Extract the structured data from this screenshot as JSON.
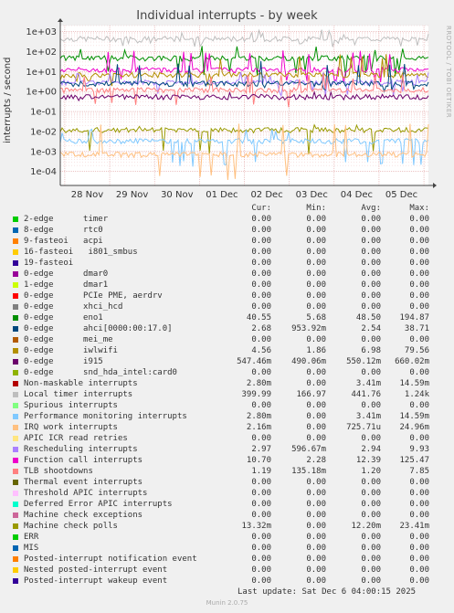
{
  "title": "Individual interrupts - by week",
  "side_text": "RRDTOOL / TOBI OETIKER",
  "footer": {
    "last_update": "Last update: Sat Dec  6 04:00:15 2025",
    "munin": "Munin 2.0.75"
  },
  "table_headers": [
    "Cur:",
    "Min:",
    "Avg:",
    "Max:"
  ],
  "chart_data": {
    "type": "line",
    "title": "Individual interrupts - by week",
    "ylabel": "interrupts / second",
    "y_scale": "log",
    "ylim": [
      2e-05,
      2000
    ],
    "y_ticks": [
      "1e+03",
      "1e+02",
      "1e+01",
      "1e+00",
      "1e-01",
      "1e-02",
      "1e-03",
      "1e-04"
    ],
    "x_ticks": [
      "28 Nov",
      "29 Nov",
      "30 Nov",
      "01 Dec",
      "02 Dec",
      "03 Dec",
      "04 Dec",
      "05 Dec"
    ],
    "grid": true,
    "series": [
      {
        "name": "2-edge      timer",
        "color": "#00cc00",
        "cur": "0.00",
        "min": "0.00",
        "avg": "0.00",
        "max": "0.00"
      },
      {
        "name": "8-edge      rtc0",
        "color": "#0066b3",
        "cur": "0.00",
        "min": "0.00",
        "avg": "0.00",
        "max": "0.00"
      },
      {
        "name": "9-fasteoi   acpi",
        "color": "#ff8000",
        "cur": "0.00",
        "min": "0.00",
        "avg": "0.00",
        "max": "0.00"
      },
      {
        "name": "16-fasteoi   i801_smbus",
        "color": "#ffcc00",
        "cur": "0.00",
        "min": "0.00",
        "avg": "0.00",
        "max": "0.00"
      },
      {
        "name": "19-fasteoi",
        "color": "#330099",
        "cur": "0.00",
        "min": "0.00",
        "avg": "0.00",
        "max": "0.00"
      },
      {
        "name": "0-edge      dmar0",
        "color": "#990099",
        "cur": "0.00",
        "min": "0.00",
        "avg": "0.00",
        "max": "0.00"
      },
      {
        "name": "1-edge      dmar1",
        "color": "#ccff00",
        "cur": "0.00",
        "min": "0.00",
        "avg": "0.00",
        "max": "0.00"
      },
      {
        "name": "0-edge      PCIe PME, aerdrv",
        "color": "#ff0000",
        "cur": "0.00",
        "min": "0.00",
        "avg": "0.00",
        "max": "0.00"
      },
      {
        "name": "0-edge      xhci_hcd",
        "color": "#808080",
        "cur": "0.00",
        "min": "0.00",
        "avg": "0.00",
        "max": "0.00"
      },
      {
        "name": "0-edge      eno1",
        "color": "#008f00",
        "cur": "40.55",
        "min": "5.68",
        "avg": "48.50",
        "max": "194.87"
      },
      {
        "name": "0-edge      ahci[0000:00:17.0]",
        "color": "#00487d",
        "cur": "2.68",
        "min": "953.92m",
        "avg": "2.54",
        "max": "38.71"
      },
      {
        "name": "0-edge      mei_me",
        "color": "#b35a00",
        "cur": "0.00",
        "min": "0.00",
        "avg": "0.00",
        "max": "0.00"
      },
      {
        "name": "0-edge      iwlwifi",
        "color": "#b38f00",
        "cur": "4.56",
        "min": "1.86",
        "avg": "6.98",
        "max": "79.56"
      },
      {
        "name": "0-edge      i915",
        "color": "#6b006b",
        "cur": "547.46m",
        "min": "490.06m",
        "avg": "550.12m",
        "max": "660.02m"
      },
      {
        "name": "0-edge      snd_hda_intel:card0",
        "color": "#8fb300",
        "cur": "0.00",
        "min": "0.00",
        "avg": "0.00",
        "max": "0.00"
      },
      {
        "name": "Non-maskable interrupts",
        "color": "#b30000",
        "cur": "2.80m",
        "min": "0.00",
        "avg": "3.41m",
        "max": "14.59m"
      },
      {
        "name": "Local timer interrupts",
        "color": "#bebebe",
        "cur": "399.99",
        "min": "166.97",
        "avg": "441.76",
        "max": "1.24k"
      },
      {
        "name": "Spurious interrupts",
        "color": "#80ff80",
        "cur": "0.00",
        "min": "0.00",
        "avg": "0.00",
        "max": "0.00"
      },
      {
        "name": "Performance monitoring interrupts",
        "color": "#80c9ff",
        "cur": "2.80m",
        "min": "0.00",
        "avg": "3.41m",
        "max": "14.59m"
      },
      {
        "name": "IRQ work interrupts",
        "color": "#ffc080",
        "cur": "2.16m",
        "min": "0.00",
        "avg": "725.71u",
        "max": "24.96m"
      },
      {
        "name": "APIC ICR read retries",
        "color": "#ffe680",
        "cur": "0.00",
        "min": "0.00",
        "avg": "0.00",
        "max": "0.00"
      },
      {
        "name": "Rescheduling interrupts",
        "color": "#aa80ff",
        "cur": "2.97",
        "min": "596.67m",
        "avg": "2.94",
        "max": "9.93"
      },
      {
        "name": "Function call interrupts",
        "color": "#ee00cc",
        "cur": "10.70",
        "min": "2.28",
        "avg": "12.39",
        "max": "125.47"
      },
      {
        "name": "TLB shootdowns",
        "color": "#ff8080",
        "cur": "1.19",
        "min": "135.18m",
        "avg": "1.20",
        "max": "7.85"
      },
      {
        "name": "Thermal event interrupts",
        "color": "#666600",
        "cur": "0.00",
        "min": "0.00",
        "avg": "0.00",
        "max": "0.00"
      },
      {
        "name": "Threshold APIC interrupts",
        "color": "#ffbfff",
        "cur": "0.00",
        "min": "0.00",
        "avg": "0.00",
        "max": "0.00"
      },
      {
        "name": "Deferred Error APIC interrupts",
        "color": "#00ffcc",
        "cur": "0.00",
        "min": "0.00",
        "avg": "0.00",
        "max": "0.00"
      },
      {
        "name": "Machine check exceptions",
        "color": "#cc6699",
        "cur": "0.00",
        "min": "0.00",
        "avg": "0.00",
        "max": "0.00"
      },
      {
        "name": "Machine check polls",
        "color": "#999900",
        "cur": "13.32m",
        "min": "0.00",
        "avg": "12.20m",
        "max": "23.41m"
      },
      {
        "name": "ERR",
        "color": "#00cc00",
        "cur": "0.00",
        "min": "0.00",
        "avg": "0.00",
        "max": "0.00"
      },
      {
        "name": "MIS",
        "color": "#0066b3",
        "cur": "0.00",
        "min": "0.00",
        "avg": "0.00",
        "max": "0.00"
      },
      {
        "name": "Posted-interrupt notification event",
        "color": "#ff8000",
        "cur": "0.00",
        "min": "0.00",
        "avg": "0.00",
        "max": "0.00"
      },
      {
        "name": "Nested posted-interrupt event",
        "color": "#ffcc00",
        "cur": "0.00",
        "min": "0.00",
        "avg": "0.00",
        "max": "0.00"
      },
      {
        "name": "Posted-interrupt wakeup event",
        "color": "#330099",
        "cur": "0.00",
        "min": "0.00",
        "avg": "0.00",
        "max": "0.00"
      }
    ],
    "plotted_levels": [
      {
        "series": "Local timer interrupts",
        "typical": 441.76,
        "min": 166.97,
        "max": 1240
      },
      {
        "series": "0-edge      eno1",
        "typical": 48.5,
        "min": 5.68,
        "max": 194.87
      },
      {
        "series": "Function call interrupts",
        "typical": 12.39,
        "min": 2.28,
        "max": 125.47
      },
      {
        "series": "0-edge      iwlwifi",
        "typical": 6.98,
        "min": 1.86,
        "max": 79.56
      },
      {
        "series": "Rescheduling interrupts",
        "typical": 2.94,
        "min": 0.59667,
        "max": 9.93
      },
      {
        "series": "0-edge      ahci[0000:00:17.0]",
        "typical": 2.54,
        "min": 0.95392,
        "max": 38.71
      },
      {
        "series": "TLB shootdowns",
        "typical": 1.2,
        "min": 0.13518,
        "max": 7.85
      },
      {
        "series": "0-edge      i915",
        "typical": 0.55012,
        "min": 0.49006,
        "max": 0.66002
      },
      {
        "series": "Machine check polls",
        "typical": 0.0122,
        "min": 0.0,
        "max": 0.02341
      },
      {
        "series": "Performance monitoring interrupts",
        "typical": 0.00341,
        "min": 0.0,
        "max": 0.01459
      },
      {
        "series": "IRQ work interrupts",
        "typical": 0.000726,
        "min": 0.0,
        "max": 0.02496
      }
    ]
  }
}
